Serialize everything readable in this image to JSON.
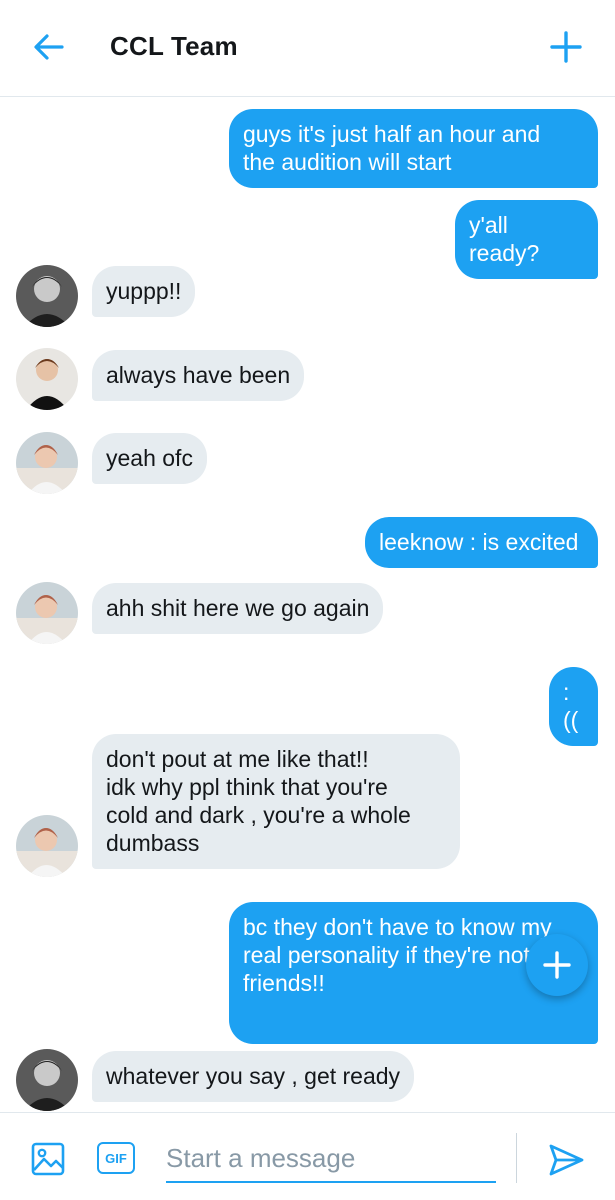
{
  "header": {
    "title": "CCL Team",
    "back_icon": "arrow-left-icon",
    "new_icon": "plus-icon"
  },
  "colors": {
    "accent": "#1da1f2",
    "incoming_bubble": "#e6ecf0",
    "text": "#14171a",
    "placeholder": "#8899a6"
  },
  "messages": [
    {
      "direction": "out",
      "text": "guys it's just half an hour and\nthe audition will start"
    },
    {
      "direction": "out",
      "text": "y'all ready?"
    },
    {
      "direction": "in",
      "avatar": "member-a",
      "text": "yuppp!!"
    },
    {
      "direction": "in",
      "avatar": "member-b",
      "text": "always have been"
    },
    {
      "direction": "in",
      "avatar": "member-c",
      "text": "yeah ofc"
    },
    {
      "direction": "out",
      "text": "leeknow : is excited"
    },
    {
      "direction": "in",
      "avatar": "member-c",
      "text": "ahh shit here we go again"
    },
    {
      "direction": "out",
      "text": ":(("
    },
    {
      "direction": "in",
      "avatar": "member-c",
      "text": "don't pout at me like that!!\nidk why ppl think that you're\ncold and dark , you're a whole\ndumbass"
    },
    {
      "direction": "out",
      "text": "bc they don't have to know my\nreal personality if they're not\nfriends!!"
    },
    {
      "direction": "in",
      "avatar": "member-a",
      "text": "whatever you say , get ready"
    }
  ],
  "composer": {
    "image_icon": "image-icon",
    "gif_label": "GIF",
    "placeholder": "Start a message",
    "value": "",
    "send_icon": "send-icon"
  },
  "fab": {
    "icon": "plus-icon"
  }
}
